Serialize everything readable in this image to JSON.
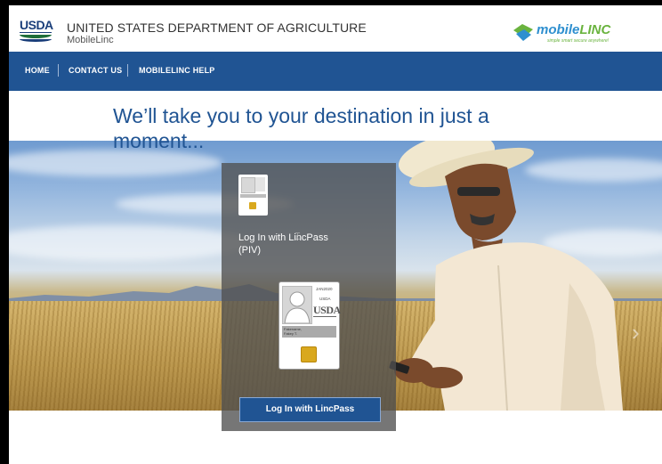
{
  "header": {
    "usda_logo_text": "USDA",
    "org_name": "UNITED STATES DEPARTMENT OF AGRICULTURE",
    "org_sub": "MobileLinc",
    "mobilelinc_brand_a": "mobile",
    "mobilelinc_brand_b": "LINC",
    "mobilelinc_tagline": "simple smart secure anywhere!"
  },
  "nav": {
    "items": [
      {
        "label": "HOME"
      },
      {
        "label": "CONTACT US"
      },
      {
        "label": "MOBILELINC HELP"
      }
    ]
  },
  "main": {
    "heading": "We’ll take you to your destination in just a moment..."
  },
  "card": {
    "label": "Log In with LincPass (PIV)",
    "card_date": "JAN2020",
    "card_agency": "USDA",
    "card_logo": "USDA",
    "card_name_line1": "Fakename,",
    "card_name_line2": "Fakey T.",
    "login_button": "Log In with LincPass"
  },
  "colors": {
    "nav_bg": "#205493",
    "heading": "#205493",
    "button_bg": "#205493"
  }
}
